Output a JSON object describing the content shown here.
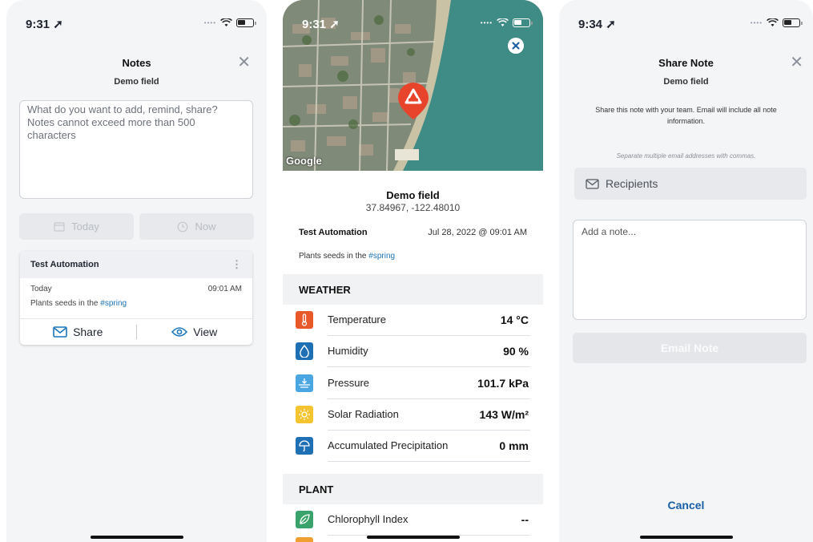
{
  "notes_screen": {
    "status_time": "9:31",
    "title": "Notes",
    "subtitle": "Demo field",
    "note_placeholder": "What do you want to add, remind, share? Notes cannot exceed more than 500 characters",
    "date_button": "Today",
    "time_button": "Now",
    "note_card": {
      "author": "Test Automation",
      "day": "Today",
      "time": "09:01 AM",
      "text_prefix": "Plants seeds in the ",
      "hashtag": "#spring",
      "share_label": "Share",
      "view_label": "View"
    }
  },
  "detail_screen": {
    "status_time": "9:31",
    "map_attribution": "Google",
    "field_name": "Demo field",
    "coordinates": "37.84967, -122.48010",
    "note": {
      "author": "Test Automation",
      "date": "Jul 28, 2022 @ 09:01 AM",
      "text_prefix": "Plants seeds in the ",
      "hashtag": "#spring"
    },
    "weather_header": "WEATHER",
    "weather": [
      {
        "label": "Temperature",
        "value": "14 °C",
        "icon": "thermometer-icon",
        "color": "#e8582a"
      },
      {
        "label": "Humidity",
        "value": "90 %",
        "icon": "water-drop-icon",
        "color": "#1f6fb5"
      },
      {
        "label": "Pressure",
        "value": "101.7 kPa",
        "icon": "pressure-icon",
        "color": "#4aa6e0"
      },
      {
        "label": "Solar Radiation",
        "value": "143 W/m²",
        "icon": "sun-icon",
        "color": "#f5c430"
      },
      {
        "label": "Accumulated Precipitation",
        "value": "0 mm",
        "icon": "rain-umbrella-icon",
        "color": "#1f6fb5"
      }
    ],
    "plant_header": "PLANT",
    "plant": [
      {
        "label": "Chlorophyll Index",
        "value": "--",
        "icon": "leaf-icon",
        "color": "#3aa36b"
      }
    ]
  },
  "share_screen": {
    "status_time": "9:34",
    "title": "Share Note",
    "subtitle": "Demo field",
    "description": "Share this note with your team. Email will include all note information.",
    "separator_hint": "Separate multiple email addresses with commas.",
    "recipients_placeholder": "Recipients",
    "note_placeholder": "Add a note...",
    "email_button": "Email Note",
    "cancel_label": "Cancel"
  },
  "colors": {
    "accent_blue": "#175fa6",
    "hashtag": "#1b75bb",
    "map_pin": "#e8442c"
  }
}
